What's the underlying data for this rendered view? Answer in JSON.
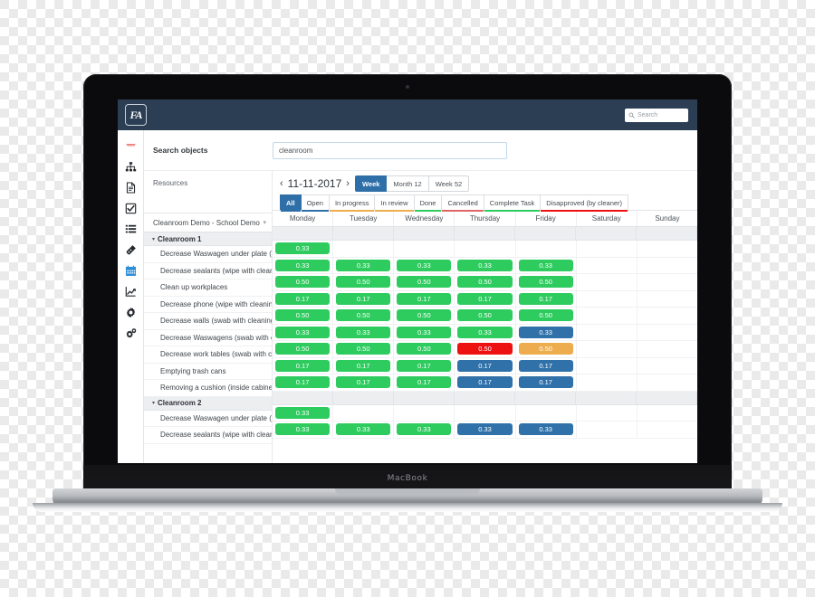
{
  "device": {
    "brand_label": "MacBook"
  },
  "colors": {
    "topbar": "#2c3e54",
    "accent_blue": "#2f6fa8",
    "green": "#2ecc5f",
    "blue": "#3071a9",
    "red": "#ee1111",
    "orange": "#edad4e",
    "group_row": "#eceef0"
  },
  "topbar": {
    "logo_text": "FA",
    "search_placeholder": "Search",
    "search_icon": "search-icon"
  },
  "sidebar": {
    "items": [
      {
        "icon": "bookmark-ribbon-icon",
        "label": "Bookmarks"
      },
      {
        "icon": "org-hierarchy-icon",
        "label": "Organization"
      },
      {
        "icon": "document-icon",
        "label": "Documents"
      },
      {
        "icon": "checkbox-task-icon",
        "label": "Tasks"
      },
      {
        "icon": "list-icon",
        "label": "Lists"
      },
      {
        "icon": "tag-icon",
        "label": "Tags"
      },
      {
        "icon": "calendar-icon",
        "label": "Planning"
      },
      {
        "icon": "line-chart-icon",
        "label": "Reports"
      },
      {
        "icon": "gear-icon",
        "label": "Settings"
      },
      {
        "icon": "gears-icon",
        "label": "Advanced settings"
      }
    ]
  },
  "search_panel": {
    "label": "Search objects",
    "value": "cleanroom",
    "placeholder": "Search objects"
  },
  "resources": {
    "label": "Resources",
    "object_selector": "Cleanroom Demo - School Demo",
    "selector_caret": "chevron-down-icon"
  },
  "planner": {
    "prev_icon": "chevron-left-icon",
    "next_icon": "chevron-right-icon",
    "date": "11-11-2017",
    "view_modes": [
      {
        "label": "Week",
        "active": true
      },
      {
        "label": "Month 12",
        "active": false
      },
      {
        "label": "Week 52",
        "active": false
      }
    ],
    "status_tabs": [
      {
        "label": "All",
        "active": true,
        "underline": "#2f6fa8"
      },
      {
        "label": "Open",
        "active": false,
        "underline": "#2f6fa8"
      },
      {
        "label": "In progress",
        "active": false,
        "underline": "#edad4e"
      },
      {
        "label": "In review",
        "active": false,
        "underline": "#edad4e"
      },
      {
        "label": "Done",
        "active": false,
        "underline": "#2ecc5f"
      },
      {
        "label": "Cancelled",
        "active": false,
        "underline": "#e06666"
      },
      {
        "label": "Complete Task",
        "active": false,
        "underline": "#2ecc5f"
      },
      {
        "label": "Disapproved (by cleaner)",
        "active": false,
        "underline": "#ee1111"
      }
    ],
    "days": [
      "Monday",
      "Tuesday",
      "Wednesday",
      "Thursday",
      "Friday",
      "Saturday",
      "Sunday"
    ],
    "rows": [
      {
        "type": "group",
        "label": "Cleanroom 1",
        "toggle": "▾"
      },
      {
        "type": "task",
        "label": "Decrease Waswagen under plate (swab with c",
        "cells": [
          {
            "v": "0.33",
            "c": "green"
          },
          null,
          null,
          null,
          null,
          null,
          null
        ]
      },
      {
        "type": "task",
        "label": "Decrease sealants (wipe with cleaning / disinf",
        "cells": [
          {
            "v": "0.33",
            "c": "green"
          },
          {
            "v": "0.33",
            "c": "green"
          },
          {
            "v": "0.33",
            "c": "green"
          },
          {
            "v": "0.33",
            "c": "green"
          },
          {
            "v": "0.33",
            "c": "green"
          },
          null,
          null
        ]
      },
      {
        "type": "task",
        "label": "Clean up workplaces",
        "cells": [
          {
            "v": "0.50",
            "c": "green"
          },
          {
            "v": "0.50",
            "c": "green"
          },
          {
            "v": "0.50",
            "c": "green"
          },
          {
            "v": "0.50",
            "c": "green"
          },
          {
            "v": "0.50",
            "c": "green"
          },
          null,
          null
        ]
      },
      {
        "type": "task",
        "label": "Decrease phone (wipe with cleaning/disinfect",
        "cells": [
          {
            "v": "0.17",
            "c": "green"
          },
          {
            "v": "0.17",
            "c": "green"
          },
          {
            "v": "0.17",
            "c": "green"
          },
          {
            "v": "0.17",
            "c": "green"
          },
          {
            "v": "0.17",
            "c": "green"
          },
          null,
          null
        ]
      },
      {
        "type": "task",
        "label": "Decrease walls (swab with cleaning/disinfectio",
        "cells": [
          {
            "v": "0.50",
            "c": "green"
          },
          {
            "v": "0.50",
            "c": "green"
          },
          {
            "v": "0.50",
            "c": "green"
          },
          {
            "v": "0.50",
            "c": "green"
          },
          {
            "v": "0.50",
            "c": "green"
          },
          null,
          null
        ]
      },
      {
        "type": "task",
        "label": "Decrease Waswagens (swab with cleaning/dis",
        "cells": [
          {
            "v": "0.33",
            "c": "green"
          },
          {
            "v": "0.33",
            "c": "green"
          },
          {
            "v": "0.33",
            "c": "green"
          },
          {
            "v": "0.33",
            "c": "green"
          },
          {
            "v": "0.33",
            "c": "blue"
          },
          null,
          null
        ]
      },
      {
        "type": "task",
        "label": "Decrease work tables (swab with cleaning/dis",
        "cells": [
          {
            "v": "0.50",
            "c": "green"
          },
          {
            "v": "0.50",
            "c": "green"
          },
          {
            "v": "0.50",
            "c": "green"
          },
          {
            "v": "0.50",
            "c": "red"
          },
          {
            "v": "0.50",
            "c": "orange"
          },
          null,
          null
        ]
      },
      {
        "type": "task",
        "label": "Emptying trash cans",
        "cells": [
          {
            "v": "0.17",
            "c": "green"
          },
          {
            "v": "0.17",
            "c": "green"
          },
          {
            "v": "0.17",
            "c": "green"
          },
          {
            "v": "0.17",
            "c": "blue"
          },
          {
            "v": "0.17",
            "c": "blue"
          },
          null,
          null
        ]
      },
      {
        "type": "task",
        "label": "Removing a cushion (inside cabinet) (wipe wit",
        "cells": [
          {
            "v": "0.17",
            "c": "green"
          },
          {
            "v": "0.17",
            "c": "green"
          },
          {
            "v": "0.17",
            "c": "green"
          },
          {
            "v": "0.17",
            "c": "blue"
          },
          {
            "v": "0.17",
            "c": "blue"
          },
          null,
          null
        ]
      },
      {
        "type": "group",
        "label": "Cleanroom 2",
        "toggle": "▾"
      },
      {
        "type": "task",
        "label": "Decrease Waswagen under plate (swab with c",
        "cells": [
          {
            "v": "0.33",
            "c": "green"
          },
          null,
          null,
          null,
          null,
          null,
          null
        ]
      },
      {
        "type": "task",
        "label": "Decrease sealants (wipe with cleaning / disinf",
        "cells": [
          {
            "v": "0.33",
            "c": "green"
          },
          {
            "v": "0.33",
            "c": "green"
          },
          {
            "v": "0.33",
            "c": "green"
          },
          {
            "v": "0.33",
            "c": "blue"
          },
          {
            "v": "0.33",
            "c": "blue"
          },
          null,
          null
        ]
      }
    ]
  }
}
